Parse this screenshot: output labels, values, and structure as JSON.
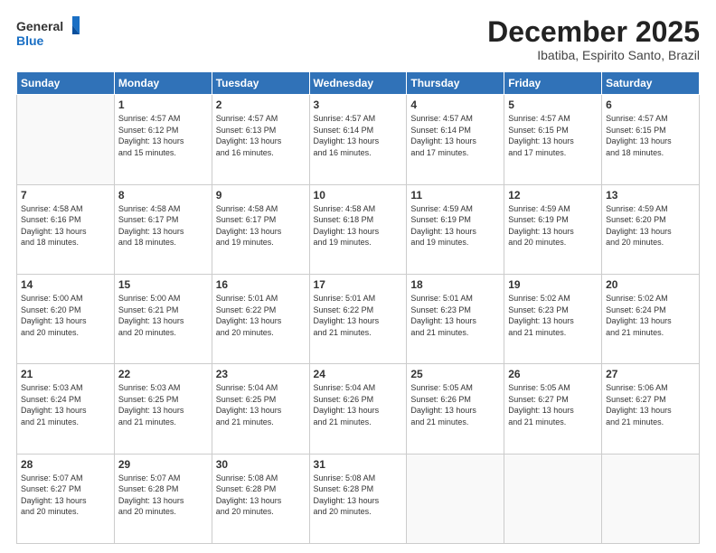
{
  "header": {
    "logo_line1": "General",
    "logo_line2": "Blue",
    "month": "December 2025",
    "location": "Ibatiba, Espirito Santo, Brazil"
  },
  "weekdays": [
    "Sunday",
    "Monday",
    "Tuesday",
    "Wednesday",
    "Thursday",
    "Friday",
    "Saturday"
  ],
  "weeks": [
    [
      {
        "day": "",
        "info": ""
      },
      {
        "day": "1",
        "info": "Sunrise: 4:57 AM\nSunset: 6:12 PM\nDaylight: 13 hours\nand 15 minutes."
      },
      {
        "day": "2",
        "info": "Sunrise: 4:57 AM\nSunset: 6:13 PM\nDaylight: 13 hours\nand 16 minutes."
      },
      {
        "day": "3",
        "info": "Sunrise: 4:57 AM\nSunset: 6:14 PM\nDaylight: 13 hours\nand 16 minutes."
      },
      {
        "day": "4",
        "info": "Sunrise: 4:57 AM\nSunset: 6:14 PM\nDaylight: 13 hours\nand 17 minutes."
      },
      {
        "day": "5",
        "info": "Sunrise: 4:57 AM\nSunset: 6:15 PM\nDaylight: 13 hours\nand 17 minutes."
      },
      {
        "day": "6",
        "info": "Sunrise: 4:57 AM\nSunset: 6:15 PM\nDaylight: 13 hours\nand 18 minutes."
      }
    ],
    [
      {
        "day": "7",
        "info": "Sunrise: 4:58 AM\nSunset: 6:16 PM\nDaylight: 13 hours\nand 18 minutes."
      },
      {
        "day": "8",
        "info": "Sunrise: 4:58 AM\nSunset: 6:17 PM\nDaylight: 13 hours\nand 18 minutes."
      },
      {
        "day": "9",
        "info": "Sunrise: 4:58 AM\nSunset: 6:17 PM\nDaylight: 13 hours\nand 19 minutes."
      },
      {
        "day": "10",
        "info": "Sunrise: 4:58 AM\nSunset: 6:18 PM\nDaylight: 13 hours\nand 19 minutes."
      },
      {
        "day": "11",
        "info": "Sunrise: 4:59 AM\nSunset: 6:19 PM\nDaylight: 13 hours\nand 19 minutes."
      },
      {
        "day": "12",
        "info": "Sunrise: 4:59 AM\nSunset: 6:19 PM\nDaylight: 13 hours\nand 20 minutes."
      },
      {
        "day": "13",
        "info": "Sunrise: 4:59 AM\nSunset: 6:20 PM\nDaylight: 13 hours\nand 20 minutes."
      }
    ],
    [
      {
        "day": "14",
        "info": "Sunrise: 5:00 AM\nSunset: 6:20 PM\nDaylight: 13 hours\nand 20 minutes."
      },
      {
        "day": "15",
        "info": "Sunrise: 5:00 AM\nSunset: 6:21 PM\nDaylight: 13 hours\nand 20 minutes."
      },
      {
        "day": "16",
        "info": "Sunrise: 5:01 AM\nSunset: 6:22 PM\nDaylight: 13 hours\nand 20 minutes."
      },
      {
        "day": "17",
        "info": "Sunrise: 5:01 AM\nSunset: 6:22 PM\nDaylight: 13 hours\nand 21 minutes."
      },
      {
        "day": "18",
        "info": "Sunrise: 5:01 AM\nSunset: 6:23 PM\nDaylight: 13 hours\nand 21 minutes."
      },
      {
        "day": "19",
        "info": "Sunrise: 5:02 AM\nSunset: 6:23 PM\nDaylight: 13 hours\nand 21 minutes."
      },
      {
        "day": "20",
        "info": "Sunrise: 5:02 AM\nSunset: 6:24 PM\nDaylight: 13 hours\nand 21 minutes."
      }
    ],
    [
      {
        "day": "21",
        "info": "Sunrise: 5:03 AM\nSunset: 6:24 PM\nDaylight: 13 hours\nand 21 minutes."
      },
      {
        "day": "22",
        "info": "Sunrise: 5:03 AM\nSunset: 6:25 PM\nDaylight: 13 hours\nand 21 minutes."
      },
      {
        "day": "23",
        "info": "Sunrise: 5:04 AM\nSunset: 6:25 PM\nDaylight: 13 hours\nand 21 minutes."
      },
      {
        "day": "24",
        "info": "Sunrise: 5:04 AM\nSunset: 6:26 PM\nDaylight: 13 hours\nand 21 minutes."
      },
      {
        "day": "25",
        "info": "Sunrise: 5:05 AM\nSunset: 6:26 PM\nDaylight: 13 hours\nand 21 minutes."
      },
      {
        "day": "26",
        "info": "Sunrise: 5:05 AM\nSunset: 6:27 PM\nDaylight: 13 hours\nand 21 minutes."
      },
      {
        "day": "27",
        "info": "Sunrise: 5:06 AM\nSunset: 6:27 PM\nDaylight: 13 hours\nand 21 minutes."
      }
    ],
    [
      {
        "day": "28",
        "info": "Sunrise: 5:07 AM\nSunset: 6:27 PM\nDaylight: 13 hours\nand 20 minutes."
      },
      {
        "day": "29",
        "info": "Sunrise: 5:07 AM\nSunset: 6:28 PM\nDaylight: 13 hours\nand 20 minutes."
      },
      {
        "day": "30",
        "info": "Sunrise: 5:08 AM\nSunset: 6:28 PM\nDaylight: 13 hours\nand 20 minutes."
      },
      {
        "day": "31",
        "info": "Sunrise: 5:08 AM\nSunset: 6:28 PM\nDaylight: 13 hours\nand 20 minutes."
      },
      {
        "day": "",
        "info": ""
      },
      {
        "day": "",
        "info": ""
      },
      {
        "day": "",
        "info": ""
      }
    ]
  ]
}
